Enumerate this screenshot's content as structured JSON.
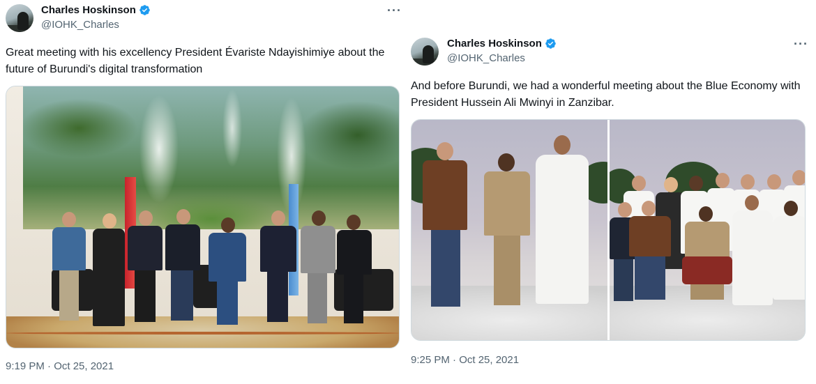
{
  "tweets": [
    {
      "author": {
        "display_name": "Charles Hoskinson",
        "handle": "@IOHK_Charles",
        "verified": true
      },
      "text": "Great meeting with his excellency President Évariste Ndayishimiye about the future of Burundi's digital transformation",
      "timestamp": "9:19 PM · Oct 25, 2021",
      "more_label": "···"
    },
    {
      "author": {
        "display_name": "Charles Hoskinson",
        "handle": "@IOHK_Charles",
        "verified": true
      },
      "text": "And before Burundi, we had a wonderful meeting about the Blue Economy with President Hussein Ali Mwinyi in Zanzibar.",
      "timestamp": "9:25 PM · Oct 25, 2021",
      "more_label": "···"
    }
  ],
  "colors": {
    "verified_blue": "#1d9bf0",
    "secondary_text": "#536471",
    "primary_text": "#0f1419",
    "border": "#cfd9de"
  },
  "icons": {
    "verified": "verified-badge-icon",
    "more": "more-horizontal-icon"
  }
}
